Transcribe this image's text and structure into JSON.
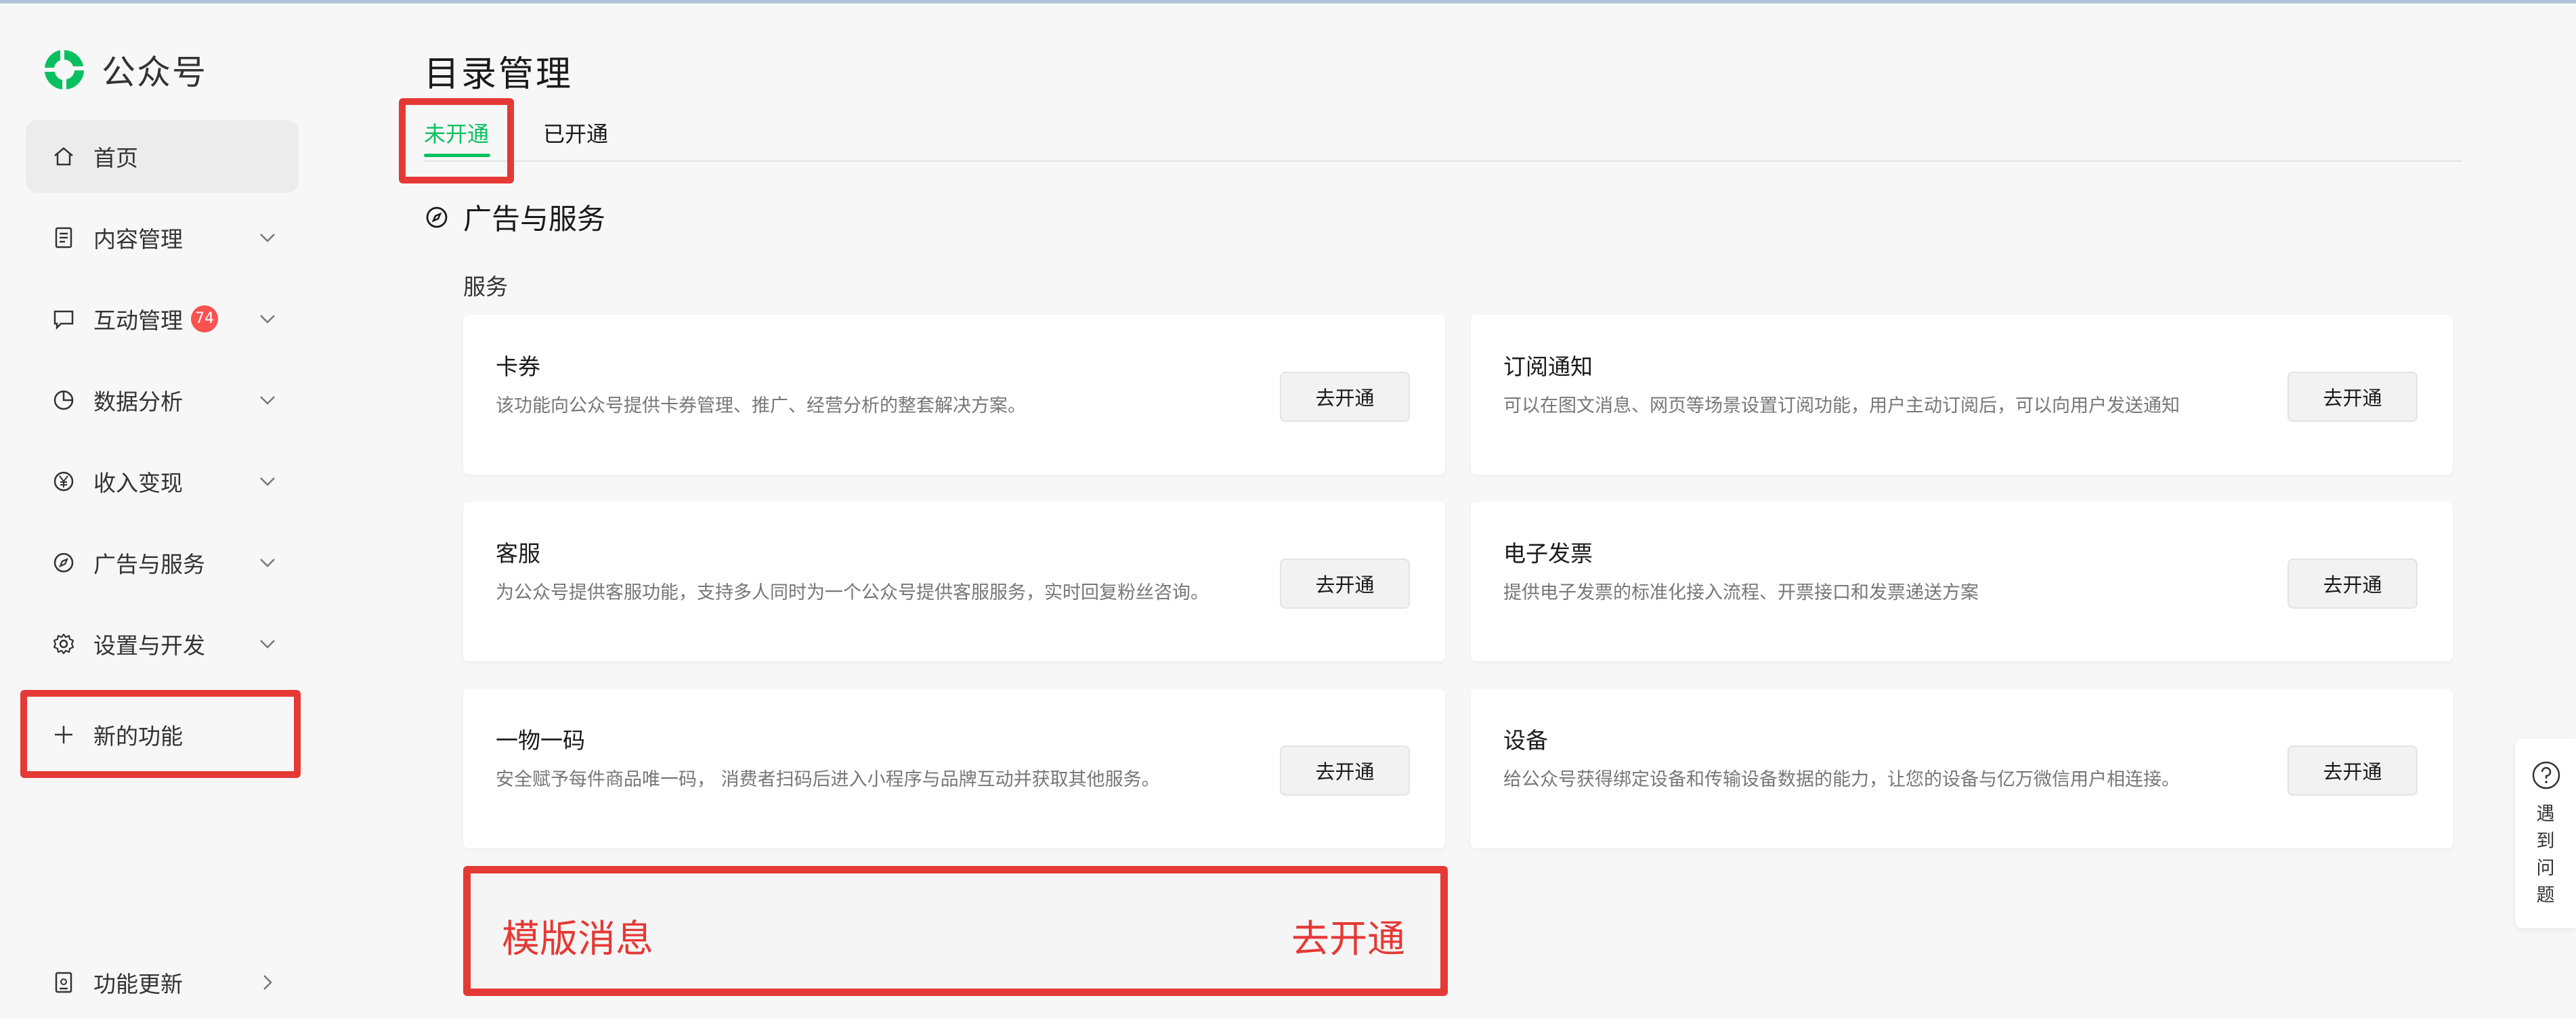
{
  "app": {
    "title": "公众号"
  },
  "sidebar": {
    "items": [
      {
        "label": "首页",
        "icon": "home-icon"
      },
      {
        "label": "内容管理",
        "icon": "document-icon"
      },
      {
        "label": "互动管理",
        "icon": "chat-icon",
        "badge": "74"
      },
      {
        "label": "数据分析",
        "icon": "pie-chart-icon"
      },
      {
        "label": "收入变现",
        "icon": "yen-icon"
      },
      {
        "label": "广告与服务",
        "icon": "compass-icon"
      },
      {
        "label": "设置与开发",
        "icon": "gear-icon"
      },
      {
        "label": "新的功能",
        "icon": "plus-icon"
      }
    ],
    "footer": {
      "label": "功能更新",
      "icon": "update-icon"
    }
  },
  "main": {
    "title": "目录管理",
    "tabs": [
      {
        "label": "未开通",
        "active": true
      },
      {
        "label": "已开通",
        "active": false
      }
    ],
    "section": {
      "title": "广告与服务"
    },
    "subsection": "服务",
    "cards": [
      {
        "title": "卡券",
        "desc": "该功能向公众号提供卡券管理、推广、经营分析的整套解决方案。",
        "button": "去开通"
      },
      {
        "title": "订阅通知",
        "desc": "可以在图文消息、网页等场景设置订阅功能，用户主动订阅后，可以向用户发送通知",
        "button": "去开通"
      },
      {
        "title": "客服",
        "desc": "为公众号提供客服功能，支持多人同时为一个公众号提供客服服务，实时回复粉丝咨询。",
        "button": "去开通"
      },
      {
        "title": "电子发票",
        "desc": "提供电子发票的标准化接入流程、开票接口和发票递送方案",
        "button": "去开通"
      },
      {
        "title": "一物一码",
        "desc": "安全赋予每件商品唯一码， 消费者扫码后进入小程序与品牌互动并获取其他服务。",
        "button": "去开通"
      },
      {
        "title": "设备",
        "desc": "给公众号获得绑定设备和传输设备数据的能力，让您的设备与亿万微信用户相连接。",
        "button": "去开通"
      }
    ],
    "template": {
      "title": "模版消息",
      "button": "去开通"
    }
  },
  "help": {
    "chars": [
      "遇",
      "到",
      "问",
      "题"
    ]
  },
  "colors": {
    "accent": "#07c160",
    "badge": "#fa5151",
    "highlight": "#e53935"
  }
}
